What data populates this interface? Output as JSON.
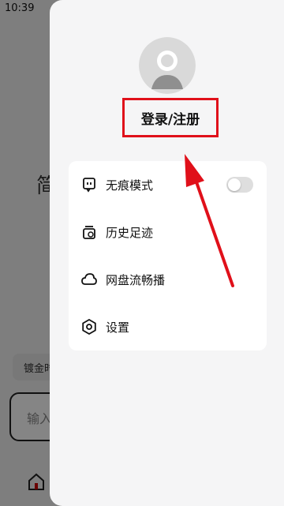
{
  "status_bar": {
    "time": "10:39"
  },
  "background": {
    "chip_text": "镀金时",
    "input_placeholder": "输入",
    "glyph": "简"
  },
  "drawer": {
    "login_label": "登录/注册",
    "menu": [
      {
        "label": "无痕模式",
        "icon": "ghost-icon",
        "toggle_on": false
      },
      {
        "label": "历史足迹",
        "icon": "history-icon"
      },
      {
        "label": "网盘流畅播",
        "icon": "cloud-icon"
      },
      {
        "label": "设置",
        "icon": "settings-icon"
      }
    ]
  },
  "colors": {
    "annotation_red": "#e0101a",
    "drawer_bg": "#f5f5f6",
    "card_bg": "#ffffff"
  }
}
